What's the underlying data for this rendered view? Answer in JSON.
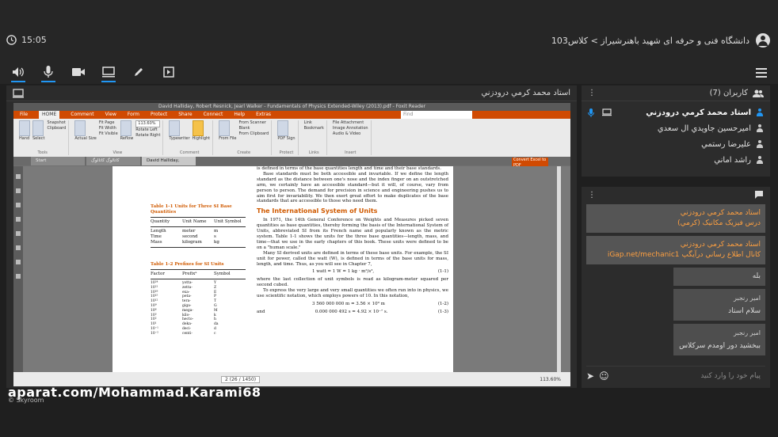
{
  "header": {
    "timer": "15:05",
    "title": "دانشگاه فنی و حرفه ای شهید باهنرشیراز > کلاس103"
  },
  "toolbar": {
    "icons": [
      "speaker-icon",
      "microphone-icon",
      "camera-icon",
      "screen-share-icon",
      "pen-icon",
      "presentation-icon"
    ]
  },
  "main_panel": {
    "title": "استاد محمد کرمي درودزني"
  },
  "screen": {
    "window_title": "David Halliday, Robert Resnick, Jearl Walker - Fundamentals of Physics Extended-Wiley (2013).pdf - Foxit Reader",
    "ribbon_tabs": [
      "File",
      "HOME",
      "Comment",
      "View",
      "Form",
      "Protect",
      "Share",
      "Connect",
      "Help",
      "Extras"
    ],
    "search_placeholder": "Find",
    "ribbon": {
      "tools": [
        "Hand",
        "Select",
        "Snapshot",
        "Clipboard"
      ],
      "tools_label": "Tools",
      "view_items": [
        "Fit Page",
        "Fit Width",
        "Fit Visible",
        "Actual Size",
        "Reflow",
        "Rotate Left",
        "Rotate Right"
      ],
      "zoom": "113.60%",
      "view_label": "View",
      "comment_items": [
        "Typewriter",
        "Highlight"
      ],
      "comment_label": "Comment",
      "create_items": [
        "From File",
        "From Scanner",
        "Blank",
        "From Clipboard"
      ],
      "create_label": "Create",
      "protect_items": [
        "PDF Sign"
      ],
      "protect_label": "Protect",
      "link_items": [
        "Link",
        "Bookmark"
      ],
      "links_label": "Links",
      "insert_items": [
        "File Attachment",
        "Image Annotation",
        "Audio & Video"
      ],
      "insert_label": "Insert"
    },
    "doc_tabs": [
      "Start",
      "کاتالوگ کاتالوگ",
      "David Halliday, Robert R..."
    ],
    "convert_button": "Convert Excel to PDF",
    "pdf": {
      "intro": "is defined in terms of the base quantities length and time and their base standards.",
      "para1": "Base standards must be both accessible and invariable. If we define the length standard as the distance between one's nose and the index finger on an outstretched arm, we certainly have an accessible standard—but it will, of course, vary from person to person. The demand for precision in science and engineering pushes us to aim first for invariability. We then exert great effort to make duplicates of the base standards that are accessible to those who need them.",
      "heading": "The International System of Units",
      "para2": "In 1971, the 14th General Conference on Weights and Measures picked seven quantities as base quantities, thereby forming the basis of the International System of Units, abbreviated SI from its French name and popularly known as the metric system. Table 1-1 shows the units for the three base quantities—length, mass, and time—that we use in the early chapters of this book. These units were defined to be on a \"human scale.\"",
      "para3": "Many SI derived units are defined in terms of these base units. For example, the SI unit for power, called the watt (W), is defined in terms of the base units for mass, length, and time. Thus, as you will see in Chapter 7,",
      "eq1": "1 watt = 1 W = 1 kg · m²/s³,",
      "eq1_no": "(1-1)",
      "para4": "where the last collection of unit symbols is read as kilogram-meter squared per second cubed.",
      "para5": "To express the very large and very small quantities we often run into in physics, we use scientific notation, which employs powers of 10. In this notation,",
      "eq2": "3 560 000 000 m = 3.56 × 10⁹ m",
      "eq2_no": "(1-2)",
      "eq3_pre": "and",
      "eq3": "0.000 000 492 s = 4.92 × 10⁻⁷ s.",
      "eq3_no": "(1-3)",
      "table1_title": "Table 1-1   Units for Three SI Base Quantities",
      "table1_headers": [
        "Quantity",
        "Unit Name",
        "Unit Symbol"
      ],
      "table1_rows": [
        [
          "Length",
          "meter",
          "m"
        ],
        [
          "Time",
          "second",
          "s"
        ],
        [
          "Mass",
          "kilogram",
          "kg"
        ]
      ],
      "table2_title": "Table 1-2   Prefixes for SI Units",
      "table2_headers": [
        "Factor",
        "Prefixᵃ",
        "Symbol"
      ],
      "table2_rows": [
        [
          "10²⁴",
          "yotta-",
          "Y"
        ],
        [
          "10²¹",
          "zetta-",
          "Z"
        ],
        [
          "10¹⁸",
          "exa-",
          "E"
        ],
        [
          "10¹⁵",
          "peta-",
          "P"
        ],
        [
          "10¹²",
          "tera-",
          "T"
        ],
        [
          "10⁹",
          "giga-",
          "G"
        ],
        [
          "10⁶",
          "mega-",
          "M"
        ],
        [
          "10³",
          "kilo-",
          "k"
        ],
        [
          "10²",
          "hecto-",
          "h"
        ],
        [
          "10¹",
          "deka-",
          "da"
        ],
        [
          "10⁻¹",
          "deci-",
          "d"
        ],
        [
          "10⁻²",
          "centi-",
          "c"
        ]
      ]
    },
    "status": {
      "page": "2 (26 / 1450)",
      "zoom": "113.60%"
    }
  },
  "watermark": "aparat.com/Mohammad.Karami68",
  "brand": "© Skyroom",
  "users_panel": {
    "title": "کاربران (7)",
    "users": [
      {
        "name": "استاد محمد کرمي درودزني",
        "me": true
      },
      {
        "name": "اميرحسين جاويدي ال سعدي",
        "me": false
      },
      {
        "name": "عليرضا رستمي",
        "me": false
      },
      {
        "name": "راشد اماني",
        "me": false
      }
    ]
  },
  "chat_panel": {
    "messages": [
      {
        "type": "hi",
        "text": "استاد محمد کرمي درودزني",
        "text2": "درس فيزيک مکانيک (کرمي)"
      },
      {
        "type": "hi",
        "text": "استاد محمد کرمي درودزني",
        "text2": "کانال اطلاع رساني درآيگپ iGap.net/mechanic1"
      },
      {
        "type": "gr",
        "name": "",
        "text": "بله"
      },
      {
        "type": "gr",
        "name": "امير رنجبر",
        "text": "سلام استاد"
      },
      {
        "type": "gr",
        "name": "امير رنجبر",
        "text": "ببخشيد دور اومدم سرکلاس"
      }
    ],
    "input_placeholder": "پيام خود را وارد کنيد"
  }
}
